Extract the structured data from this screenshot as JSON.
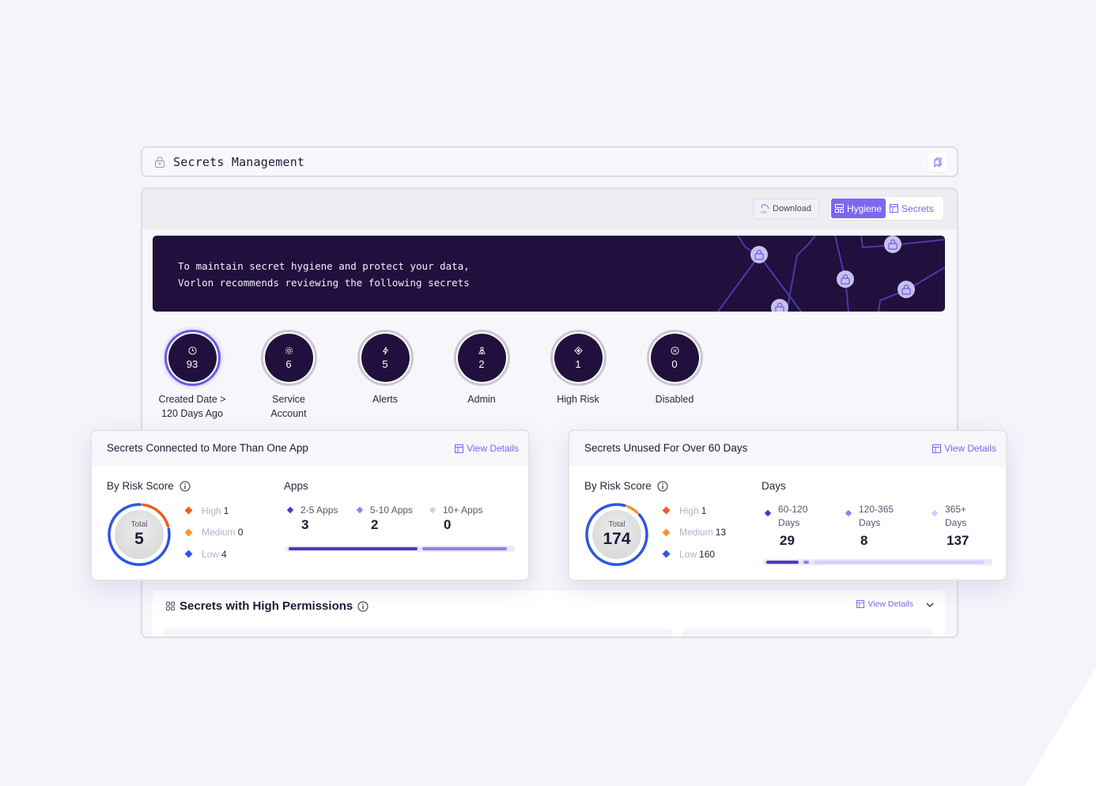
{
  "header": {
    "title": "Secrets Management",
    "lock_icon": "lock-icon",
    "bookmark_icon": "bookmarks-icon"
  },
  "toolbar": {
    "download_label": "Download",
    "download_icon": "csv-file-icon",
    "view_toggle": [
      {
        "label": "Hygiene",
        "icon": "grid-layout-icon",
        "active": true
      },
      {
        "label": "Secrets",
        "icon": "table-icon",
        "active": false
      }
    ]
  },
  "banner": {
    "line1": "To maintain secret hygiene and protect your data,",
    "line2": "Vorlon recommends reviewing the following secrets"
  },
  "stats": [
    {
      "value": "93",
      "label_line1": "Created Date >",
      "label_line2": "120 Days Ago",
      "icon": "clock-icon"
    },
    {
      "value": "6",
      "label_line1": "Service",
      "label_line2": "Account",
      "icon": "gear-icon"
    },
    {
      "value": "5",
      "label_line1": "Alerts",
      "label_line2": "",
      "icon": "lightning-icon"
    },
    {
      "value": "2",
      "label_line1": "Admin",
      "label_line2": "",
      "icon": "admin-user-icon"
    },
    {
      "value": "1",
      "label_line1": "High Risk",
      "label_line2": "",
      "icon": "risk-diamond-icon"
    },
    {
      "value": "0",
      "label_line1": "Disabled",
      "label_line2": "",
      "icon": "pause-circle-icon"
    }
  ],
  "colors": {
    "accent": "#7b68ee",
    "dark_purple": "#21103d",
    "high": "#f05a28",
    "medium": "#f7922e",
    "low": "#2f55e4",
    "bucket1": "#4a3bc4",
    "bucket2": "#8f7ff5",
    "bucket3": "#d3cdfa"
  },
  "cards": [
    {
      "title": "Secrets Connected to More Than One App",
      "view_details": "View Details",
      "risk_label": "By Risk Score",
      "total_label": "Total",
      "total": "5",
      "risk": [
        {
          "label": "High",
          "value": 1,
          "color": "#f05a28"
        },
        {
          "label": "Medium",
          "value": 0,
          "color": "#f7922e"
        },
        {
          "label": "Low",
          "value": 4,
          "color": "#2f55e4"
        }
      ],
      "bucket_title": "Apps",
      "buckets": [
        {
          "label_line1": "2-5 Apps",
          "label_line2": "",
          "value": 3
        },
        {
          "label_line1": "5-10 Apps",
          "label_line2": "",
          "value": 2
        },
        {
          "label_line1": "10+ Apps",
          "label_line2": "",
          "value": 0
        }
      ]
    },
    {
      "title": "Secrets Unused For Over 60 Days",
      "view_details": "View Details",
      "risk_label": "By Risk Score",
      "total_label": "Total",
      "total": "174",
      "risk": [
        {
          "label": "High",
          "value": 1,
          "color": "#f05a28"
        },
        {
          "label": "Medium",
          "value": 13,
          "color": "#f7922e"
        },
        {
          "label": "Low",
          "value": 160,
          "color": "#2f55e4"
        }
      ],
      "bucket_title": "Days",
      "buckets": [
        {
          "label_line1": "60-120",
          "label_line2": "Days",
          "value": 29
        },
        {
          "label_line1": "120-365",
          "label_line2": "Days",
          "value": 8
        },
        {
          "label_line1": "365+",
          "label_line2": "Days",
          "value": 137
        }
      ]
    }
  ],
  "high_permissions": {
    "title": "Secrets with High Permissions",
    "view_details": "View Details"
  }
}
